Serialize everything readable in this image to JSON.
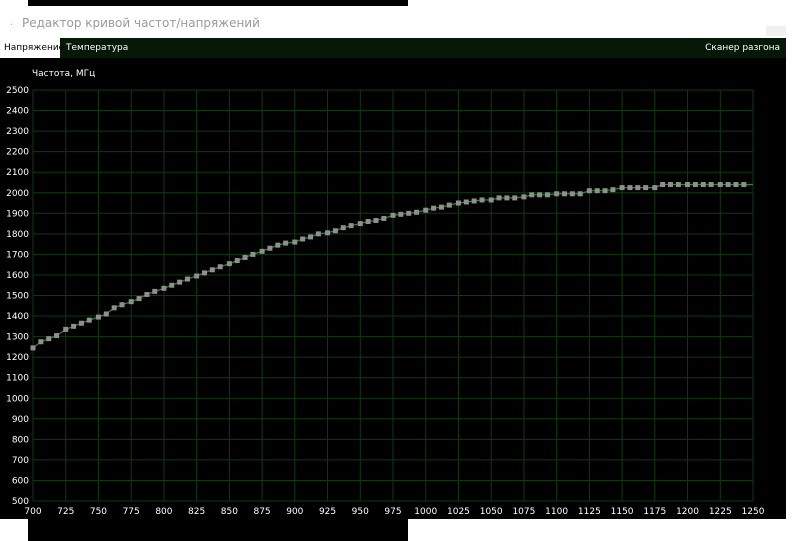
{
  "window": {
    "title": "Редактор кривой частот/напряжений"
  },
  "tabs": {
    "voltage": "Напряжение",
    "temperature": "Температура",
    "scanner": "Сканер разгона"
  },
  "chart_data": {
    "type": "scatter",
    "title": "",
    "ylabel": "Частота, МГц",
    "xlabel": "",
    "xlim": [
      700,
      1250
    ],
    "ylim": [
      500,
      2500
    ],
    "grid": true,
    "line_color": "#2e8b2e",
    "marker_color": "#8f8f8f",
    "xticks": [
      700,
      725,
      750,
      775,
      800,
      825,
      850,
      875,
      900,
      925,
      950,
      975,
      1000,
      1025,
      1050,
      1075,
      1100,
      1125,
      1150,
      1175,
      1200,
      1225,
      1250
    ],
    "yticks": [
      500,
      600,
      700,
      800,
      900,
      1000,
      1100,
      1200,
      1300,
      1400,
      1500,
      1600,
      1700,
      1800,
      1900,
      2000,
      2100,
      2200,
      2300,
      2400,
      2500
    ],
    "series": [
      {
        "x": [
          700,
          706,
          712,
          718,
          725,
          731,
          737,
          743,
          750,
          756,
          762,
          768,
          775,
          781,
          787,
          793,
          800,
          806,
          812,
          818,
          825,
          831,
          837,
          843,
          850,
          856,
          862,
          868,
          875,
          881,
          887,
          893,
          900,
          906,
          912,
          918,
          925,
          931,
          937,
          943,
          950,
          956,
          962,
          968,
          975,
          981,
          987,
          993,
          1000,
          1006,
          1012,
          1018,
          1025,
          1031,
          1037,
          1043,
          1050,
          1056,
          1062,
          1068,
          1075,
          1081,
          1087,
          1093,
          1100,
          1106,
          1112,
          1118,
          1125,
          1131,
          1137,
          1143,
          1150,
          1156,
          1162,
          1168,
          1175,
          1181,
          1187,
          1193,
          1200,
          1206,
          1212,
          1218,
          1225,
          1231,
          1237,
          1243
        ],
        "y": [
          1245,
          1275,
          1290,
          1305,
          1335,
          1350,
          1365,
          1380,
          1395,
          1410,
          1440,
          1455,
          1470,
          1485,
          1505,
          1520,
          1535,
          1550,
          1565,
          1580,
          1595,
          1610,
          1625,
          1640,
          1655,
          1670,
          1685,
          1700,
          1715,
          1730,
          1745,
          1755,
          1760,
          1775,
          1785,
          1800,
          1805,
          1815,
          1830,
          1840,
          1850,
          1860,
          1865,
          1875,
          1890,
          1895,
          1900,
          1905,
          1915,
          1925,
          1930,
          1940,
          1950,
          1955,
          1960,
          1965,
          1965,
          1975,
          1975,
          1975,
          1980,
          1990,
          1990,
          1990,
          1995,
          1995,
          1995,
          1995,
          2010,
          2010,
          2010,
          2015,
          2025,
          2025,
          2025,
          2025,
          2025,
          2040,
          2040,
          2040,
          2040,
          2040,
          2040,
          2040,
          2040,
          2040,
          2040,
          2040
        ]
      }
    ]
  }
}
